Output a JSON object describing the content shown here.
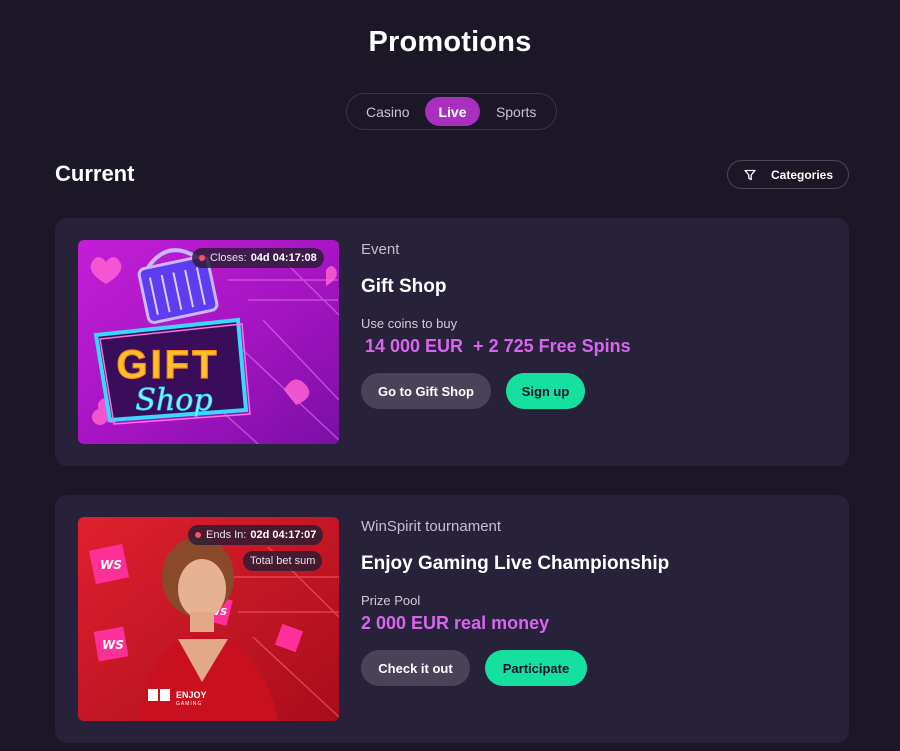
{
  "page": {
    "title": "Promotions"
  },
  "tabs": [
    {
      "label": "Casino",
      "active": false
    },
    {
      "label": "Live",
      "active": true
    },
    {
      "label": "Sports",
      "active": false
    }
  ],
  "section": {
    "title": "Current",
    "categories_label": "Categories"
  },
  "promotions": [
    {
      "category": "Event",
      "title": "Gift Shop",
      "badge_label": "Closes:",
      "badge_time": "04d 04:17:08",
      "image_text_1": "GIFT",
      "image_text_2": "Shop",
      "sublabel": "Use coins to buy",
      "prize": "14 000 EUR  + 2 725 Free Spins",
      "secondary_button": "Go to Gift Shop",
      "primary_button": "Sign up"
    },
    {
      "category": "WinSpirit tournament",
      "title": "Enjoy Gaming Live Championship",
      "badge_label": "Ends In:",
      "badge_time": "02d 04:17:07",
      "badge_extra": "Total bet sum",
      "image_brand": "ENJOY",
      "image_brand_sub": "GAMING",
      "image_ws": "WS",
      "sublabel": "Prize Pool",
      "prize": "2 000 EUR real money",
      "secondary_button": "Check it out",
      "primary_button": "Participate"
    }
  ],
  "colors": {
    "background": "#1c1726",
    "card": "#28213a",
    "accent_tab": "#a92fbf",
    "prize": "#d766ef",
    "primary_button": "#15e0a0",
    "secondary_button": "#4a4258"
  }
}
